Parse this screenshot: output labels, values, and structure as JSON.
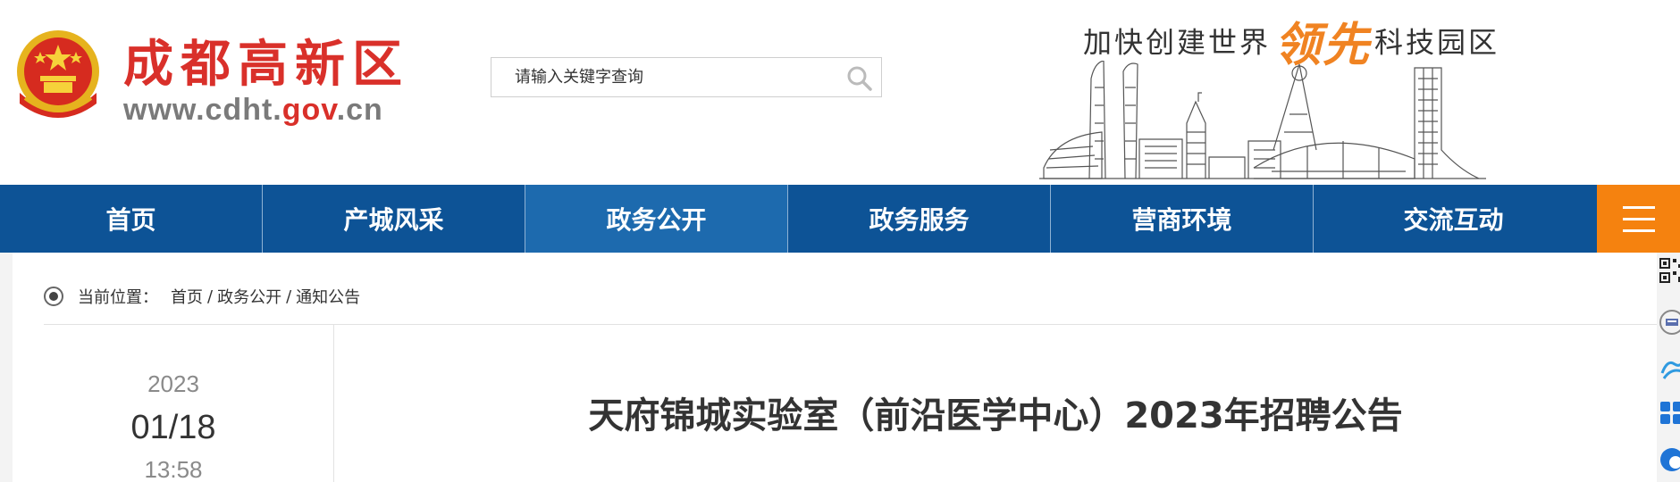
{
  "header": {
    "site_name": "成都高新区",
    "site_url_prefix": "www.cdht.",
    "site_url_gov": "gov",
    "site_url_suffix": ".cn",
    "slogan_part1": "加快创建世界",
    "slogan_highlight": "领先",
    "slogan_part2": "科技园区"
  },
  "search": {
    "placeholder": "请输入关键字查询",
    "value": ""
  },
  "nav": {
    "items": [
      {
        "label": "首页"
      },
      {
        "label": "产城风采"
      },
      {
        "label": "政务公开"
      },
      {
        "label": "政务服务"
      },
      {
        "label": "营商环境"
      },
      {
        "label": "交流互动"
      }
    ],
    "active": "政务公开"
  },
  "breadcrumb": {
    "label": "当前位置：",
    "items": [
      "首页",
      "政务公开",
      "通知公告"
    ],
    "separator": "/"
  },
  "article": {
    "year": "2023",
    "month_day": "01/18",
    "time": "13:58",
    "title": "天府锦城实验室（前沿医学中心）2023年招聘公告"
  },
  "colors": {
    "nav_bg": "#0d5396",
    "nav_active": "#1d6aae",
    "menu_button": "#f5820f",
    "brand_red": "#d9302a",
    "slogan_orange": "#f08322"
  },
  "icons": [
    "national-emblem-icon",
    "search-icon",
    "menu-icon",
    "location-dot-icon",
    "qr-code-icon",
    "accessibility-icon",
    "elder-mode-icon",
    "grid-apps-icon",
    "english-icon"
  ]
}
